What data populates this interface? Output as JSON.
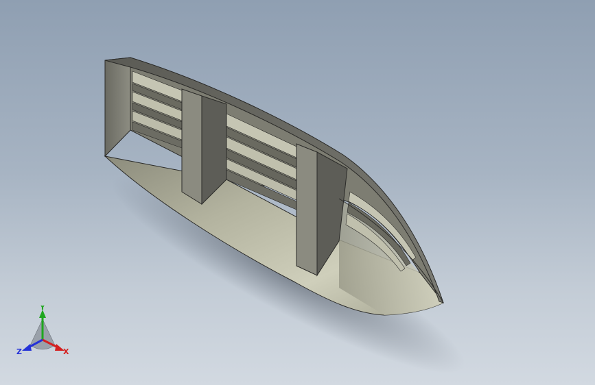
{
  "viewport": {
    "background_top": "#8f9fb2",
    "background_bottom": "#d2d9e1"
  },
  "model": {
    "name": "hull",
    "colors": {
      "exterior_light": "#c9c9b4",
      "exterior_mid": "#a8a893",
      "exterior_dark": "#77776a",
      "inner_wall": "#8a8a7e",
      "inner_wall_dark": "#5c5c55",
      "deck_edge": "#6e6e66",
      "stringer_light": "#c5c5b3",
      "stringer_dark": "#6a6a60",
      "edge": "#2a2a28"
    }
  },
  "triad": {
    "x_label": "X",
    "y_label": "Y",
    "z_label": "Z",
    "x_color": "#d42020",
    "y_color": "#1fa61f",
    "z_color": "#2432d8"
  }
}
